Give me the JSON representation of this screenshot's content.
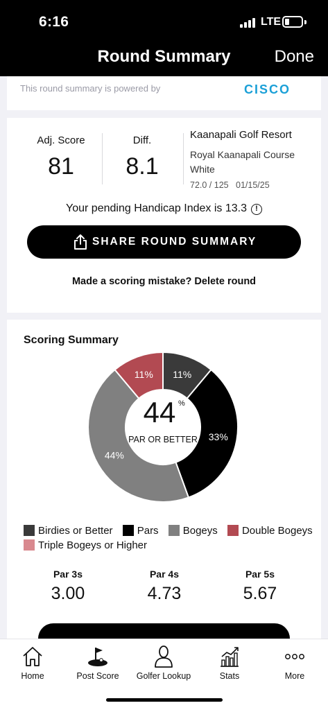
{
  "status_bar": {
    "time": "6:16",
    "network": "LTE",
    "battery_level": 0.2
  },
  "nav": {
    "title": "Round Summary",
    "done_label": "Done"
  },
  "sponsor": {
    "powered_text": "This round summary is powered by",
    "logo_text": "CISCO",
    "logo_color": "#1ba0d7"
  },
  "round": {
    "adj_score_label": "Adj. Score",
    "adj_score": "81",
    "diff_label": "Diff.",
    "diff": "8.1",
    "course_name": "Kaanapali Golf Resort",
    "course_detail": "Royal Kaanapali Course White",
    "rating_slope": "72.0 / 125",
    "date": "01/15/25",
    "handicap_text": "Your pending Handicap Index is 13.3",
    "share_label": "SHARE ROUND SUMMARY",
    "mistake_text": "Made a scoring mistake? Delete round"
  },
  "scoring_summary": {
    "title": "Scoring Summary",
    "center_value": "44",
    "center_unit": "%",
    "center_label": "PAR OR BETTER",
    "legend": [
      {
        "label": "Birdies or Better",
        "color": "#3a3a3a"
      },
      {
        "label": "Pars",
        "color": "#000000"
      },
      {
        "label": "Bogeys",
        "color": "#808080"
      },
      {
        "label": "Double Bogeys",
        "color": "#b24a52"
      },
      {
        "label": "Triple Bogeys or Higher",
        "color": "#d9898f"
      }
    ],
    "pars": [
      {
        "label": "Par 3s",
        "value": "3.00"
      },
      {
        "label": "Par 4s",
        "value": "4.73"
      },
      {
        "label": "Par 5s",
        "value": "5.67"
      }
    ]
  },
  "chart_data": {
    "type": "pie",
    "categories": [
      "Birdies or Better",
      "Pars",
      "Bogeys",
      "Double Bogeys"
    ],
    "values": [
      11,
      33,
      44,
      11
    ],
    "labels": [
      "11%",
      "33%",
      "44%",
      "11%"
    ],
    "colors": [
      "#3a3a3a",
      "#000000",
      "#808080",
      "#b24a52"
    ]
  },
  "tabs": [
    {
      "label": "Home",
      "icon": "home-icon"
    },
    {
      "label": "Post Score",
      "icon": "golf-flag-icon"
    },
    {
      "label": "Golfer Lookup",
      "icon": "person-icon"
    },
    {
      "label": "Stats",
      "icon": "stats-icon"
    },
    {
      "label": "More",
      "icon": "more-icon"
    }
  ]
}
